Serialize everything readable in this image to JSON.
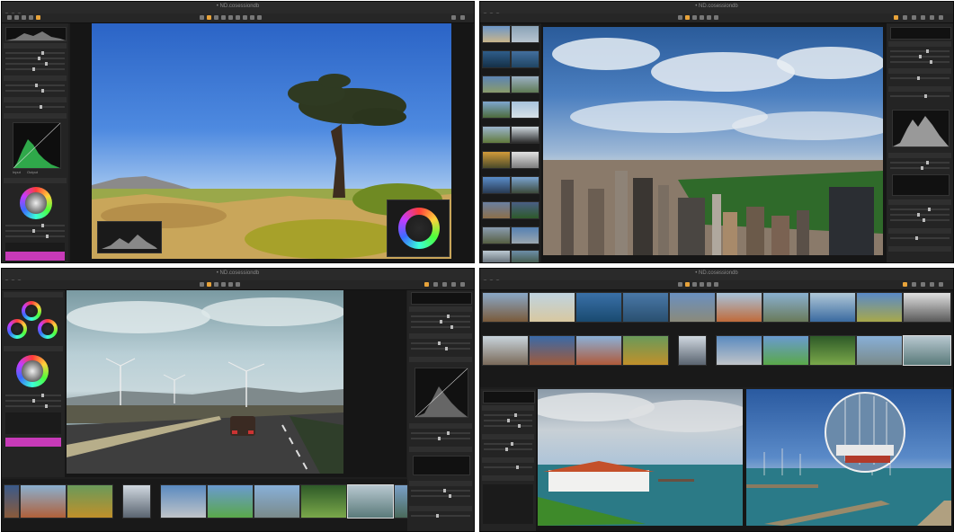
{
  "windows": [
    {
      "id": "top-left",
      "title": "• ND.cosessiondb",
      "viewer_caption": "",
      "histogram_labels": [
        "Input",
        "Output"
      ],
      "photo_subject": "lone-tree-meadow"
    },
    {
      "id": "top-right",
      "title": "• ND.cosessiondb",
      "viewer_caption": "",
      "photo_subject": "city-skyline"
    },
    {
      "id": "bottom-left",
      "title": "• ND.cosessiondb",
      "viewer_caption": "",
      "photo_subject": "wind-turbines-highway"
    },
    {
      "id": "bottom-right",
      "title": "• ND.cosessiondb",
      "photo_subject": "harbor-compare"
    }
  ],
  "colors": {
    "window_bg": "#1e1e1e",
    "panel_bg": "#242424",
    "accent": "#e8a33a",
    "swatch": "#c73ab8"
  },
  "icons": [
    "camera-icon",
    "crop-icon",
    "brush-icon",
    "eyedropper-icon",
    "loupe-icon",
    "color-wheel-icon",
    "histogram-icon",
    "curve-icon"
  ]
}
